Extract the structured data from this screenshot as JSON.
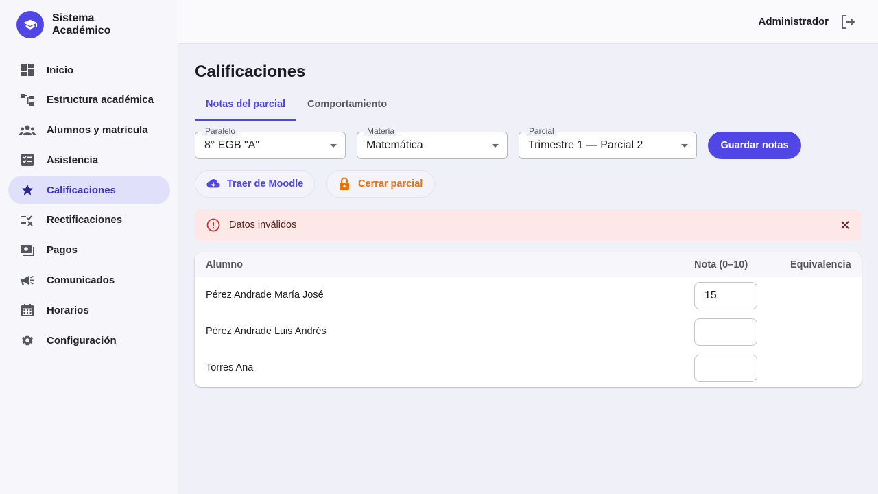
{
  "app": {
    "brand_line1": "Sistema",
    "brand_line2": "Académico"
  },
  "sidebar": {
    "items": [
      {
        "label": "Inicio",
        "icon": "dashboard-icon",
        "active": false
      },
      {
        "label": "Estructura académica",
        "icon": "hierarchy-icon",
        "active": false
      },
      {
        "label": "Alumnos y matrícula",
        "icon": "group-icon",
        "active": false
      },
      {
        "label": "Asistencia",
        "icon": "checklist-icon",
        "active": false
      },
      {
        "label": "Calificaciones",
        "icon": "star-icon",
        "active": true
      },
      {
        "label": "Rectificaciones",
        "icon": "rule-icon",
        "active": false
      },
      {
        "label": "Pagos",
        "icon": "payments-icon",
        "active": false
      },
      {
        "label": "Comunicados",
        "icon": "megaphone-icon",
        "active": false
      },
      {
        "label": "Horarios",
        "icon": "calendar-icon",
        "active": false
      },
      {
        "label": "Configuración",
        "icon": "gear-icon",
        "active": false
      }
    ]
  },
  "header": {
    "user": "Administrador"
  },
  "main": {
    "title": "Calificaciones",
    "tabs": [
      {
        "label": "Notas del parcial",
        "active": true
      },
      {
        "label": "Comportamiento",
        "active": false
      }
    ],
    "filters": {
      "paralelo": {
        "label": "Paralelo",
        "value": "8° EGB \"A\""
      },
      "materia": {
        "label": "Materia",
        "value": "Matemática"
      },
      "parcial": {
        "label": "Parcial",
        "value": "Trimestre 1 — Parcial 2"
      }
    },
    "save_label": "Guardar notas",
    "moodle_label": "Traer de Moodle",
    "close_label": "Cerrar parcial",
    "alert": {
      "text": "Datos inválidos"
    },
    "table": {
      "headers": {
        "student": "Alumno",
        "grade": "Nota (0–10)",
        "equivalence": "Equivalencia"
      },
      "rows": [
        {
          "name": "Pérez Andrade María José",
          "grade": "15"
        },
        {
          "name": "Pérez Andrade Luis Andrés",
          "grade": ""
        },
        {
          "name": "Torres Ana",
          "grade": ""
        }
      ]
    }
  },
  "colors": {
    "accent": "#4f46e5",
    "warning": "#e8720c",
    "error": "#d32f2f",
    "active_nav_bg": "#e0e0fb"
  }
}
